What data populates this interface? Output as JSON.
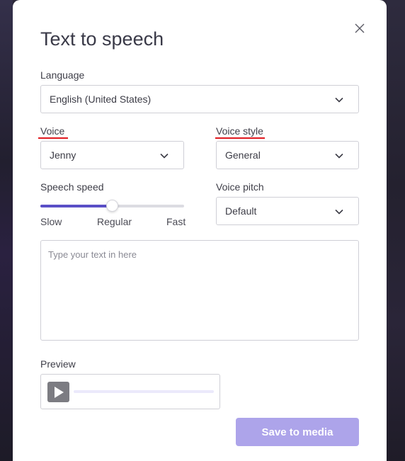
{
  "dialog": {
    "title": "Text to speech",
    "close_icon": "close-icon"
  },
  "language": {
    "label": "Language",
    "selected": "English (United States)"
  },
  "voice": {
    "label": "Voice",
    "selected": "Jenny"
  },
  "voice_style": {
    "label": "Voice style",
    "selected": "General"
  },
  "speech_speed": {
    "label": "Speech speed",
    "min_label": "Slow",
    "mid_label": "Regular",
    "max_label": "Fast",
    "value_fraction": 0.5
  },
  "voice_pitch": {
    "label": "Voice pitch",
    "selected": "Default"
  },
  "text_input": {
    "placeholder": "Type your text in here",
    "value": ""
  },
  "preview": {
    "label": "Preview",
    "progress_fraction": 0
  },
  "actions": {
    "save_label": "Save to media"
  },
  "colors": {
    "accent": "#5a4fc7",
    "save_button": "#ada4ea",
    "annotation_underline": "#e0191f"
  }
}
